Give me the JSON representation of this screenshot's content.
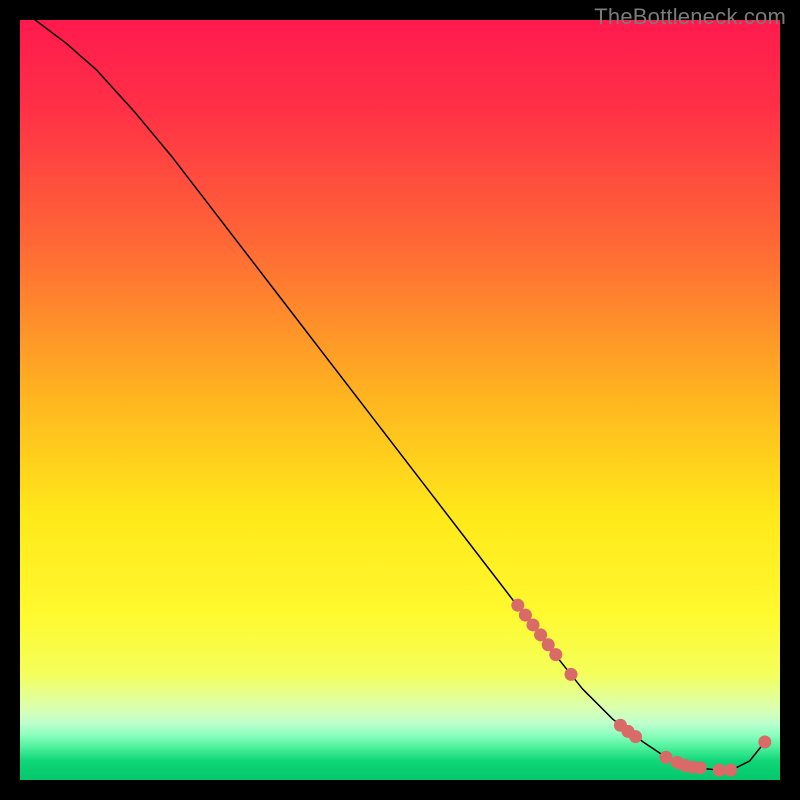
{
  "watermark": "TheBottleneck.com",
  "chart_data": {
    "type": "line",
    "title": "",
    "xlabel": "",
    "ylabel": "",
    "xlim": [
      0,
      100
    ],
    "ylim": [
      0,
      100
    ],
    "grid": false,
    "series": [
      {
        "name": "curve",
        "style": "line-solid",
        "color": "#000000",
        "x": [
          2,
          6,
          10,
          15,
          20,
          25,
          30,
          35,
          40,
          45,
          50,
          55,
          60,
          65,
          70,
          74,
          78,
          82,
          85,
          88,
          90,
          92,
          94,
          96,
          98
        ],
        "y": [
          100,
          97,
          93.5,
          88,
          82,
          75.5,
          69,
          62.5,
          56,
          49.5,
          43,
          36.5,
          30,
          23.5,
          17,
          12,
          8,
          5,
          3,
          2,
          1.5,
          1.3,
          1.5,
          2.5,
          5
        ]
      },
      {
        "name": "markers",
        "style": "scatter",
        "color": "#d96a67",
        "x": [
          65.5,
          66.5,
          67.5,
          68.5,
          69.5,
          70.5,
          72.5,
          79,
          80,
          81,
          85,
          86.5,
          87.5,
          88.5,
          89.5,
          92,
          93.5,
          98
        ],
        "y": [
          23,
          21.7,
          20.4,
          19.1,
          17.8,
          16.5,
          13.9,
          7.2,
          6.4,
          5.7,
          3,
          2.3,
          1.9,
          1.7,
          1.6,
          1.3,
          1.3,
          5
        ]
      }
    ],
    "background": {
      "type": "vertical-gradient",
      "stops": [
        {
          "offset": 0.0,
          "color": "#ff1a4e"
        },
        {
          "offset": 0.12,
          "color": "#ff3146"
        },
        {
          "offset": 0.3,
          "color": "#ff6a35"
        },
        {
          "offset": 0.5,
          "color": "#ffb61f"
        },
        {
          "offset": 0.65,
          "color": "#ffe81a"
        },
        {
          "offset": 0.78,
          "color": "#fff92e"
        },
        {
          "offset": 0.86,
          "color": "#f4ff5a"
        },
        {
          "offset": 0.905,
          "color": "#daffb0"
        },
        {
          "offset": 0.925,
          "color": "#bfffce"
        },
        {
          "offset": 0.94,
          "color": "#8dffbf"
        },
        {
          "offset": 0.955,
          "color": "#56f3a0"
        },
        {
          "offset": 0.975,
          "color": "#0fd677"
        },
        {
          "offset": 1.0,
          "color": "#05c76d"
        }
      ]
    }
  }
}
